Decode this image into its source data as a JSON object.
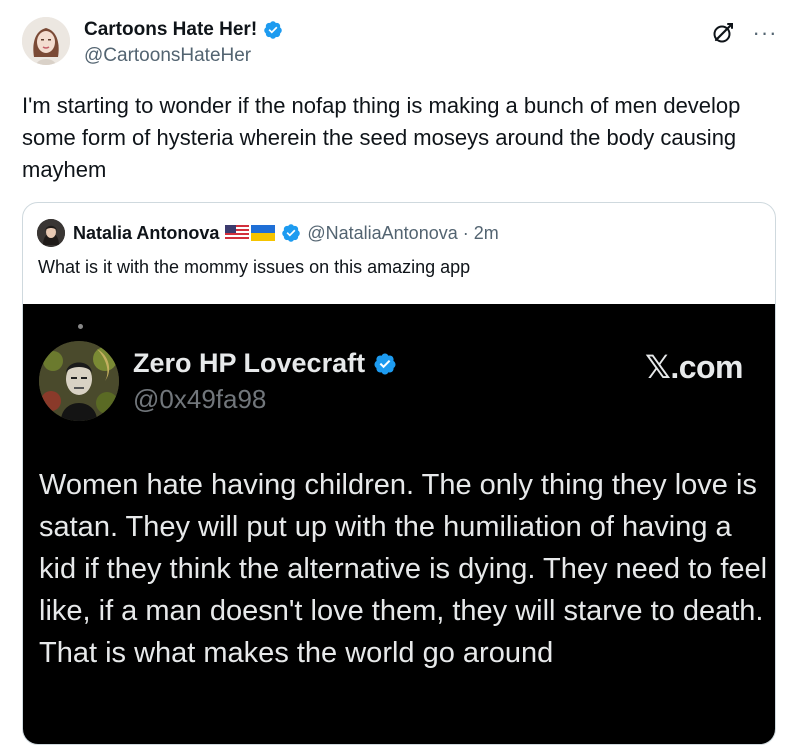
{
  "tweet": {
    "author": {
      "display_name": "Cartoons Hate Her!",
      "handle": "@CartoonsHateHer",
      "avatar_icon": "woman-portrait-avatar",
      "verified_icon": "verified-badge-icon"
    },
    "actions": {
      "grok_icon": "grok-icon",
      "more_icon": "more-options-icon",
      "more_label": "···"
    },
    "text": "I'm starting to wonder if the nofap thing is making a bunch of men develop some form of hysteria wherein the seed moseys around the body causing mayhem",
    "quote": {
      "display_name": "Natalia Antonova",
      "flags": [
        "us-flag-icon",
        "ukraine-flag-icon"
      ],
      "handle": "@NataliaAntonova",
      "separator": "·",
      "time": "2m",
      "text": "What is it with the mommy issues on this amazing app",
      "media": {
        "display_name": "Zero HP Lovecraft",
        "handle": "@0x49fa98",
        "site": "𝕏.com",
        "text": "Women hate having children. The only thing they love is satan. They will put up with the humiliation of having a kid if they think the alternative is dying. They need to feel like, if a man doesn't love them, they will starve to death. That is what makes the world go around"
      }
    }
  },
  "colors": {
    "verified_blue": "#1d9bf0",
    "secondary_text": "#536471",
    "border": "#cfd9de"
  }
}
